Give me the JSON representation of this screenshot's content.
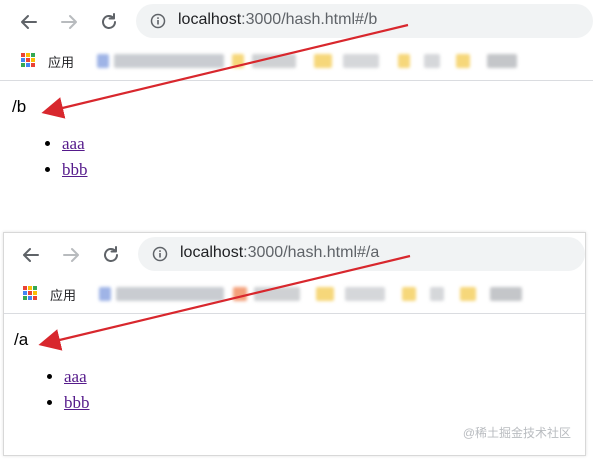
{
  "browser_top": {
    "url_host": "localhost",
    "url_rest": ":3000/hash.html#/b",
    "bookmarks_label": "应用",
    "page_hash": "/b",
    "links": [
      "aaa",
      "bbb"
    ]
  },
  "browser_bottom": {
    "url_host": "localhost",
    "url_rest": ":3000/hash.html#/a",
    "bookmarks_label": "应用",
    "page_hash": "/a",
    "links": [
      "aaa",
      "bbb"
    ]
  },
  "watermark": "@稀土掘金技术社区",
  "colors": {
    "annotation_arrow": "#d8272d",
    "visited_link": "#551a8b",
    "omnibox_bg": "#f1f3f4"
  },
  "icons": [
    "back-arrow-icon",
    "forward-arrow-icon",
    "reload-icon",
    "info-icon",
    "apps-grid-icon"
  ]
}
